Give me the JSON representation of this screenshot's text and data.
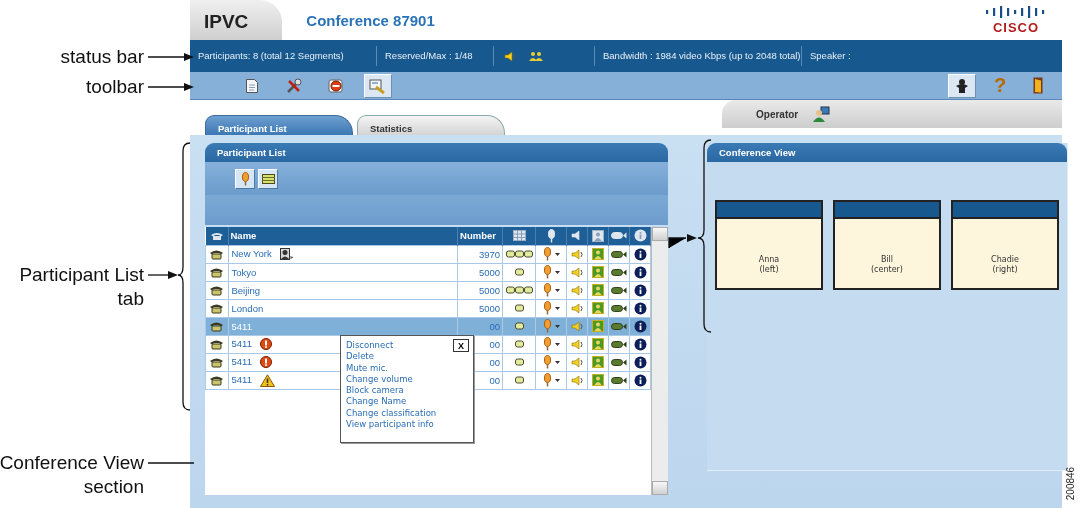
{
  "callouts": [
    {
      "text": "status bar",
      "kind": "arrow"
    },
    {
      "text": "toolbar",
      "kind": "arrow"
    },
    {
      "text": "Participant List tab",
      "kind": "brace"
    },
    {
      "text": "Conference View section",
      "kind": "line"
    }
  ],
  "header": {
    "app_tab": "IPVC",
    "conference_title": "Conference 87901",
    "logo_text": "CISCO"
  },
  "status_bar": {
    "participants": "Participants: 8 (total 12 Segments)",
    "reserved": "Reserved/Max : 1/48",
    "bandwidth": "Bandwidth : 1984 video Kbps (up to 2048 total)",
    "speaker": "Speaker :"
  },
  "toolbar": {
    "left": [
      {
        "kind": "document",
        "pressed": false
      },
      {
        "kind": "tools",
        "pressed": false
      },
      {
        "kind": "stop",
        "pressed": false
      },
      {
        "kind": "pencil",
        "pressed": true
      }
    ],
    "right": [
      {
        "kind": "person",
        "pressed": true
      },
      {
        "kind": "help",
        "glyph": "?",
        "pressed": false
      },
      {
        "kind": "exit",
        "pressed": false
      }
    ]
  },
  "operator_tab": {
    "label": "Operator"
  },
  "tabs": [
    {
      "label": "Participant List",
      "selected": true
    },
    {
      "label": "Statistics",
      "selected": false
    }
  ],
  "participant_panel": {
    "title": "Participant List",
    "columns": [
      {
        "kind": "phone"
      },
      {
        "kind": "text",
        "label": "Name"
      },
      {
        "kind": "text",
        "label": "Number"
      },
      {
        "kind": "layout"
      },
      {
        "kind": "mic"
      },
      {
        "kind": "speaker"
      },
      {
        "kind": "portrait"
      },
      {
        "kind": "camera"
      },
      {
        "kind": "info"
      }
    ],
    "rows": [
      {
        "name": "New York",
        "number": "3970",
        "layout": {
          "kind": "triple"
        },
        "badge": {
          "kind": "presenter"
        },
        "selected": false
      },
      {
        "name": "Tokyo",
        "number": "5000",
        "layout": {
          "kind": "single"
        },
        "selected": false
      },
      {
        "name": "Beijing",
        "number": "5000",
        "layout": {
          "kind": "triple"
        },
        "selected": false
      },
      {
        "name": "London",
        "number": "5000",
        "layout": {
          "kind": "single"
        },
        "selected": false
      },
      {
        "name": "5411",
        "number": "00",
        "layout": {
          "kind": "single"
        },
        "selected": true
      },
      {
        "name": "5411",
        "number": "00",
        "layout": {
          "kind": "single"
        },
        "badge": {
          "kind": "error"
        },
        "selected": false
      },
      {
        "name": "5411",
        "number": "00",
        "layout": {
          "kind": "single"
        },
        "badge": {
          "kind": "error"
        },
        "selected": false
      },
      {
        "name": "5411",
        "number": "00",
        "layout": {
          "kind": "single"
        },
        "badge": {
          "kind": "warning"
        },
        "selected": false
      }
    ],
    "context_menu": {
      "close": "X",
      "items": [
        "Disconnect",
        "Delete",
        "Mute mic.",
        "Change volume",
        "Block camera",
        "Change Name",
        "Change classification",
        "View participant info"
      ]
    }
  },
  "conference_view": {
    "title": "Conference View",
    "boxes": [
      {
        "name": "Anna",
        "position": "(left)"
      },
      {
        "name": "Bill",
        "position": "(center)"
      },
      {
        "name": "Chadie",
        "position": "(right)"
      }
    ]
  },
  "figure_id": "200846"
}
